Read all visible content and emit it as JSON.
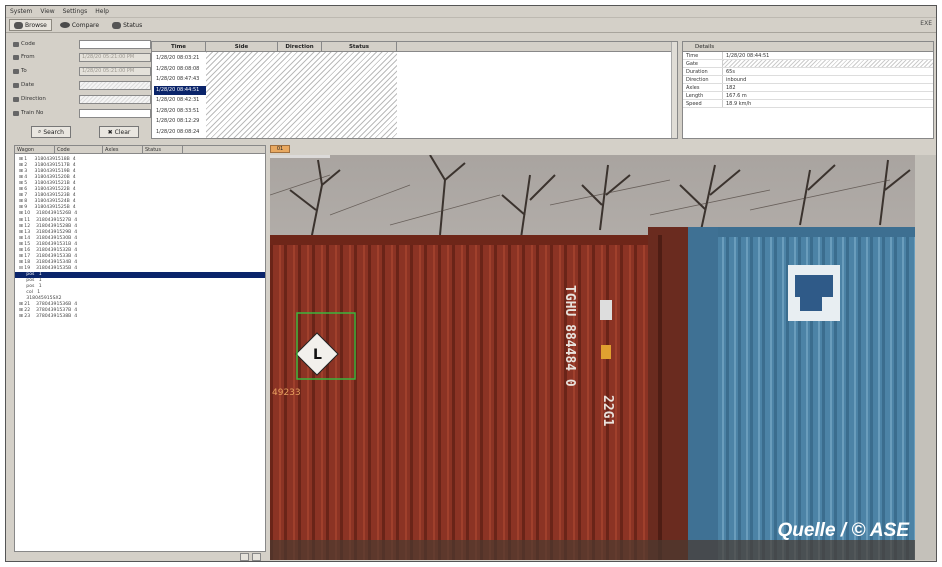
{
  "menu": [
    "System",
    "View",
    "Settings",
    "Help"
  ],
  "toolbar": {
    "browse": "Browse",
    "compare": "Compare",
    "status": "Status",
    "corner": "EXE"
  },
  "search": {
    "code_label": "Code",
    "from_label": "From",
    "to_label": "To",
    "date_label": "Date",
    "direction_label": "Direction",
    "train_label": "Train No",
    "from_value": "1/28/20 05:21:00 PM",
    "to_value": "1/28/20 05:21:00 PM",
    "search_button": "Search",
    "clear_button": "Clear"
  },
  "results": {
    "columns": [
      "Time",
      "Side",
      "Direction",
      "Status"
    ],
    "rows": [
      "1/28/20 08:03:21",
      "1/28/20 08:08:08",
      "1/28/20 08:47:43",
      "1/28/20 08:44:51",
      "1/28/20 08:42:31",
      "1/28/20 08:33:51",
      "1/28/20 08:12:29",
      "1/28/20 08:08:24"
    ],
    "selected_index": 3
  },
  "details": {
    "title": "Details",
    "rows": [
      {
        "k": "Time",
        "v": "1/28/20 08:44:51"
      },
      {
        "k": "Gate",
        "v": ""
      },
      {
        "k": "Duration",
        "v": "65s"
      },
      {
        "k": "Direction",
        "v": "inbound"
      },
      {
        "k": "Axles",
        "v": "182"
      },
      {
        "k": "Length",
        "v": "167.6 m"
      },
      {
        "k": "Speed",
        "v": "18.9 km/h"
      }
    ]
  },
  "tree": {
    "columns": [
      "Wagon",
      "Code",
      "Axles",
      "Status"
    ],
    "rows": [
      "⊞ 1     31804391518B  4",
      "⊞ 2     31804391517B  4",
      "⊞ 3     31804391519B  4",
      "⊞ 4     31804391520B  4",
      "⊞ 5     31804391521B  4",
      "⊞ 6     31804391522B  4",
      "⊞ 7     31804391523B  4",
      "⊞ 8     31804391524B  4",
      "⊞ 9     31804391525B  4",
      "⊞ 10    31804391526B  4",
      "⊞ 11    31804391527B  4",
      "⊞ 12    31804391528B  4",
      "⊞ 13    31804391529B  4",
      "⊞ 14    31804391530B  4",
      "⊞ 15    31804391531B  4",
      "⊞ 16    31804391532B  4",
      "⊞ 17    31804391533B  4",
      "⊞ 18    31804391534B  4",
      "⊟ 19    31804391535B  4",
      "     pos   1",
      "     pos   1",
      "     pos   1",
      "     col   1",
      "     318045915SX2",
      "⊞ 21    37804391536B  4",
      "⊞ 22    37804391537B  4",
      "⊞ 23    37804391538B  4"
    ],
    "selected_index": 19
  },
  "image": {
    "tab_label": "01",
    "container_code": "TGHU 884484 0",
    "type_code": "22G1",
    "roi_text": "49233",
    "hazard_symbol": "L",
    "watermark": "Quelle / © ASE"
  }
}
